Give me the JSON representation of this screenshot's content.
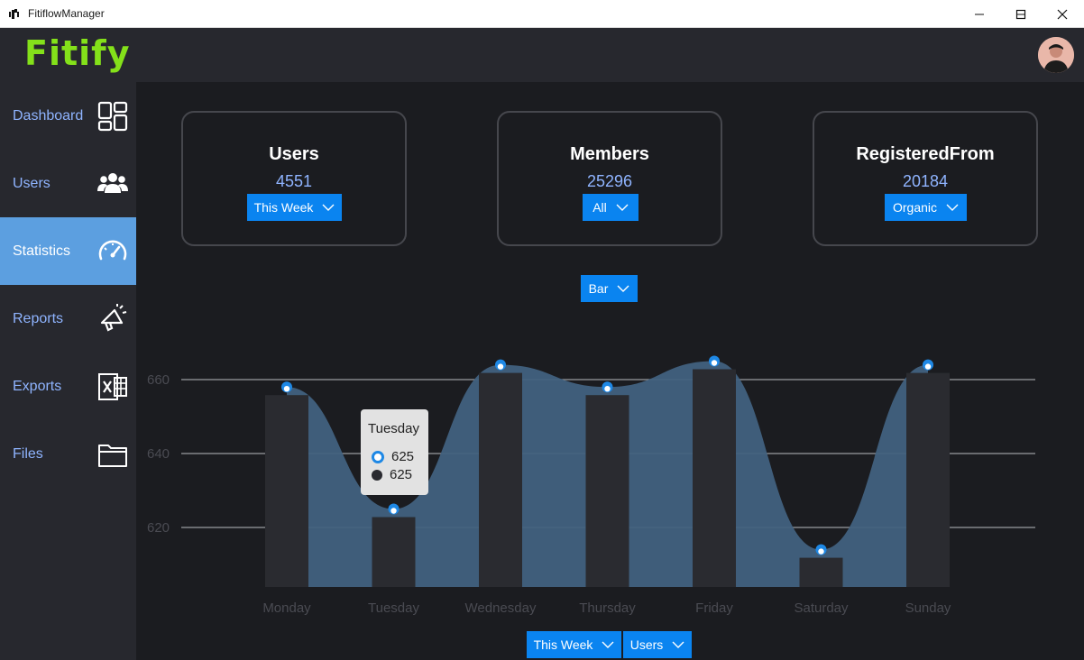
{
  "window": {
    "title": "FitiflowManager"
  },
  "header": {
    "logo": "Fitify"
  },
  "sidebar": {
    "items": [
      {
        "label": "Dashboard",
        "icon": "dashboard-icon"
      },
      {
        "label": "Users",
        "icon": "users-icon"
      },
      {
        "label": "Statistics",
        "icon": "speedometer-icon",
        "active": true
      },
      {
        "label": "Reports",
        "icon": "megaphone-icon"
      },
      {
        "label": "Exports",
        "icon": "excel-icon"
      },
      {
        "label": "Files",
        "icon": "folder-icon"
      }
    ]
  },
  "cards": [
    {
      "title": "Users",
      "value": "4551",
      "dropdown": "This Week"
    },
    {
      "title": "Members",
      "value": "25296",
      "dropdown": "All"
    },
    {
      "title": "RegisteredFrom",
      "value": "20184",
      "dropdown": "Organic"
    }
  ],
  "chart_type_dropdown": "Bar",
  "bottom_dropdowns": {
    "period": "This Week",
    "metric": "Users"
  },
  "colors": {
    "accent": "#0a84f0",
    "active_nav": "#5c9fe0",
    "logo": "#84e11a",
    "area": "#41617f",
    "bar": "#2a2b30"
  },
  "chart_data": {
    "type": "bar",
    "categories": [
      "Monday",
      "Tuesday",
      "Wednesday",
      "Thursday",
      "Friday",
      "Saturday",
      "Sunday"
    ],
    "series": [
      {
        "values": [
          658,
          625,
          664,
          658,
          665,
          614,
          664
        ]
      },
      {
        "values": [
          658,
          625,
          664,
          658,
          665,
          614,
          664
        ]
      }
    ],
    "yticks": [
      "620",
      "640",
      "660"
    ],
    "grid": true
  },
  "tooltip": {
    "title": "Tuesday",
    "values": [
      "625",
      "625"
    ]
  }
}
